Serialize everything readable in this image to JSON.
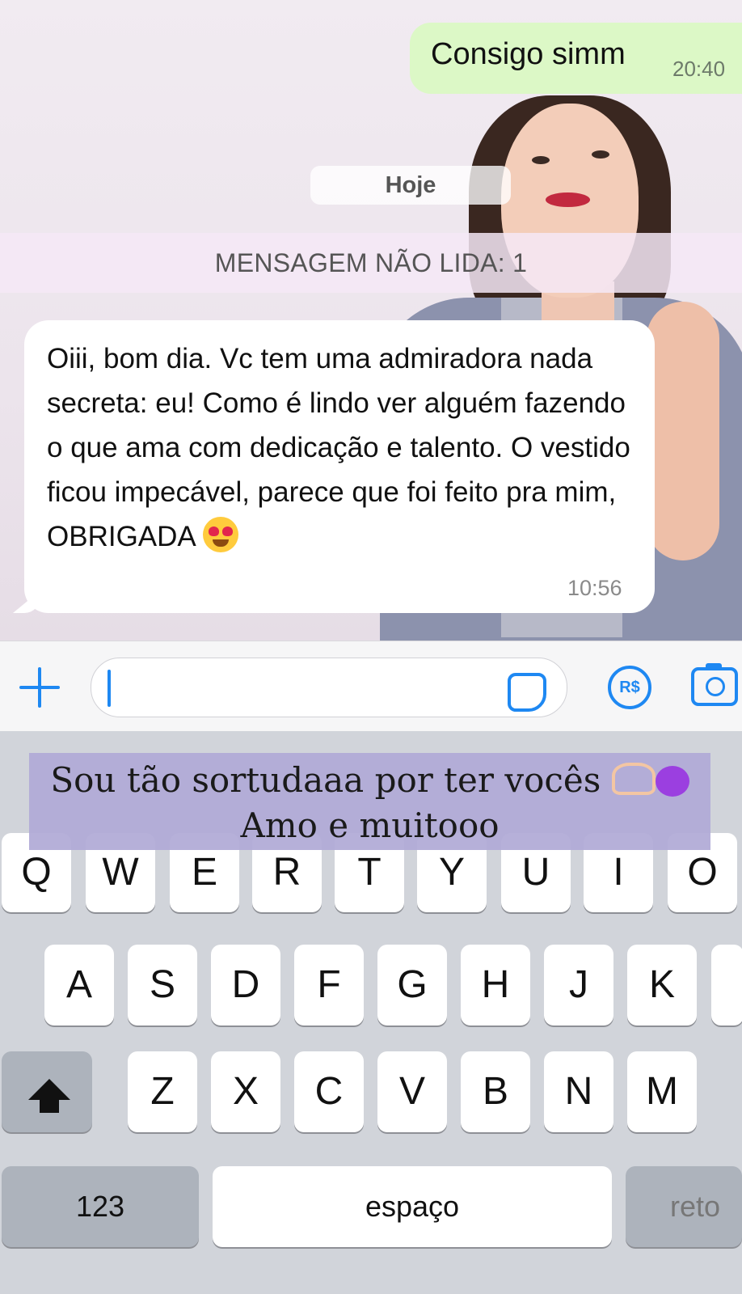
{
  "chat": {
    "outgoing": {
      "text": "Consigo simm",
      "time": "20:40"
    },
    "day_label": "Hoje",
    "unread_label": "MENSAGEM NÃO LIDA: 1",
    "incoming": {
      "text": "Oiii, bom dia. Vc tem uma admiradora nada secreta: eu! Como é lindo ver alguém fazendo o que ama com dedicação e talento. O vestido ficou impecável, parece que foi feito pra mim, OBRIGADA",
      "emoji": "smiling-face-with-heart-eyes",
      "time": "10:56"
    }
  },
  "composer": {
    "input_value": "",
    "payment_label": "R$",
    "icons": [
      "plus-icon",
      "sticker-icon",
      "payment-icon",
      "camera-icon"
    ],
    "accent": "#1e88f2"
  },
  "overlay_caption": {
    "line1": "Sou tão sortudaaa por ter vocês",
    "line2": "Amo e muitooo",
    "emojis": [
      "heart-hands",
      "purple-heart"
    ]
  },
  "keyboard": {
    "row1": [
      "Q",
      "W",
      "E",
      "R",
      "T",
      "Y",
      "U",
      "I",
      "O"
    ],
    "row2": [
      "A",
      "S",
      "D",
      "F",
      "G",
      "H",
      "J",
      "K"
    ],
    "row3": [
      "Z",
      "X",
      "C",
      "V",
      "B",
      "N",
      "M"
    ],
    "numbers_label": "123",
    "space_label": "espaço",
    "return_label": "reto"
  }
}
